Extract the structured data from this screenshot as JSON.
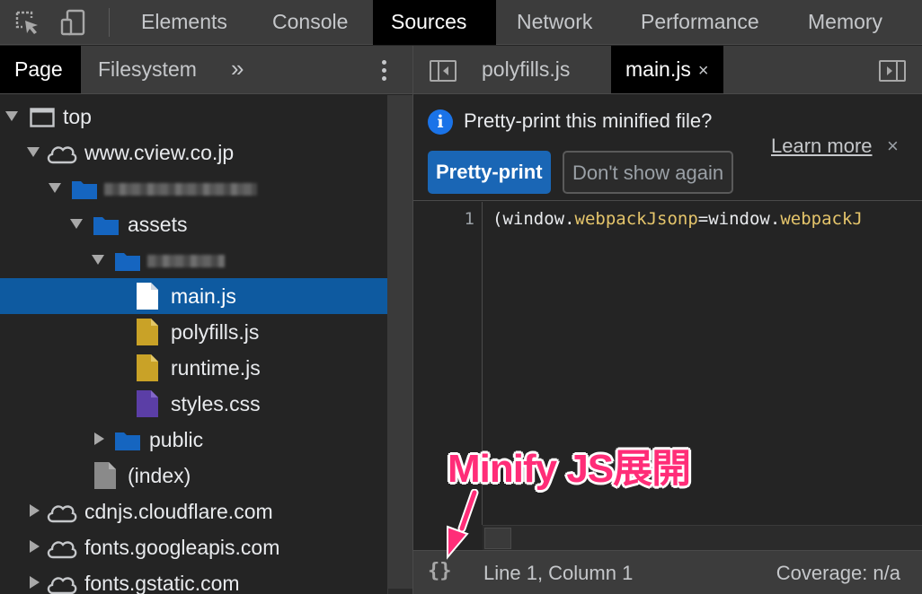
{
  "toolbar": {
    "inspect_icon": "inspect-element-icon",
    "device_icon": "device-toggle-icon",
    "tabs": [
      {
        "label": "Elements",
        "active": false
      },
      {
        "label": "Console",
        "active": false
      },
      {
        "label": "Sources",
        "active": true
      },
      {
        "label": "Network",
        "active": false
      },
      {
        "label": "Performance",
        "active": false
      },
      {
        "label": "Memory",
        "active": false
      }
    ]
  },
  "navigator": {
    "tabs": [
      {
        "label": "Page",
        "active": true
      },
      {
        "label": "Filesystem",
        "active": false
      }
    ],
    "more": "»",
    "tree": [
      {
        "label": "top",
        "type": "frame",
        "expanded": true
      },
      {
        "label": "www.cview.co.jp",
        "type": "domain",
        "expanded": true
      },
      {
        "label": "",
        "type": "folder",
        "expanded": true,
        "redacted": true
      },
      {
        "label": "assets",
        "type": "folder",
        "expanded": true
      },
      {
        "label": "",
        "type": "folder",
        "expanded": true,
        "redacted": true
      },
      {
        "label": "main.js",
        "type": "file-js",
        "selected": true
      },
      {
        "label": "polyfills.js",
        "type": "file-js"
      },
      {
        "label": "runtime.js",
        "type": "file-js"
      },
      {
        "label": "styles.css",
        "type": "file-css"
      },
      {
        "label": "public",
        "type": "folder",
        "expanded": false
      },
      {
        "label": "(index)",
        "type": "file-doc"
      },
      {
        "label": "cdnjs.cloudflare.com",
        "type": "domain",
        "expanded": false
      },
      {
        "label": "fonts.googleapis.com",
        "type": "domain",
        "expanded": false
      },
      {
        "label": "fonts.gstatic.com",
        "type": "domain",
        "expanded": false
      }
    ]
  },
  "editor": {
    "tabs": [
      {
        "label": "polyfills.js",
        "active": false
      },
      {
        "label": "main.js",
        "active": true,
        "close": "×"
      }
    ],
    "infobar": {
      "message": "Pretty-print this minified file?",
      "learn_more": "Learn more",
      "close": "×",
      "primary_button": "Pretty-print",
      "secondary_button": "Don't show again"
    },
    "code": {
      "line_number": "1",
      "tokens": [
        {
          "text": "(window.",
          "kind": "plain"
        },
        {
          "text": "webpackJsonp",
          "kind": "prop"
        },
        {
          "text": "=window.",
          "kind": "plain"
        },
        {
          "text": "webpackJ",
          "kind": "prop"
        }
      ]
    },
    "status": {
      "pretty_print_icon": "{}",
      "position": "Line 1, Column 1",
      "coverage": "Coverage: n/a"
    }
  },
  "annotation": {
    "text": "Minify JS展開",
    "color": "#ff2d78"
  },
  "colors": {
    "selected_row": "#0e5aa0",
    "primary_button": "#1a66b5",
    "js_file": "#c9a227",
    "css_file": "#5b3ea6",
    "folder": "#1565c0"
  }
}
